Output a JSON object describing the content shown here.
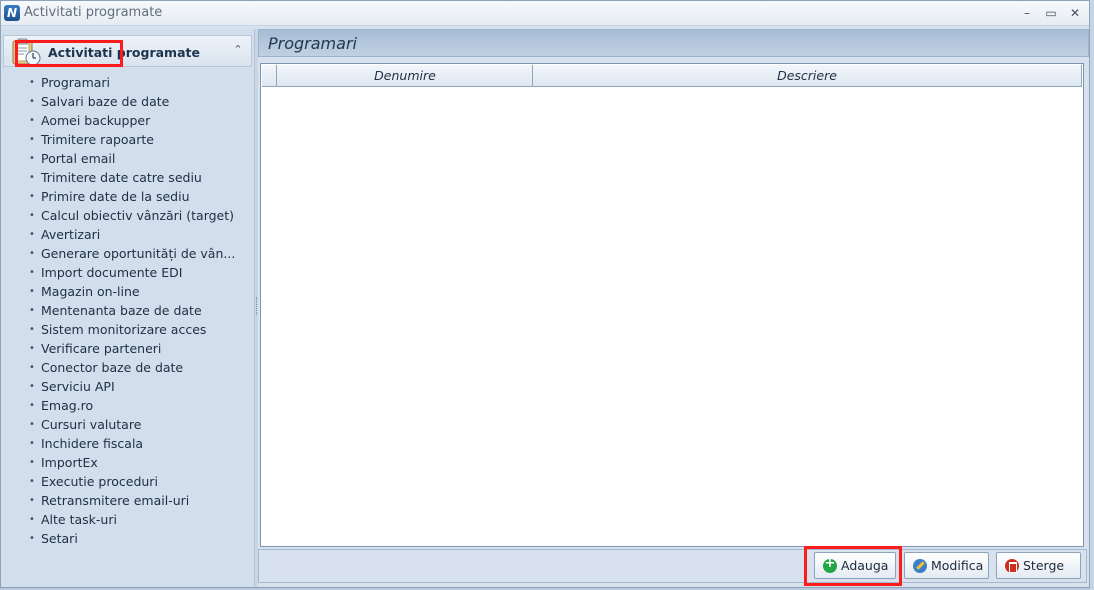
{
  "window": {
    "title": "Activitati programate",
    "icon_letter": "N",
    "controls": {
      "minimize": "–",
      "maximize": "▭",
      "close": "✕"
    }
  },
  "nav": {
    "header_title": "Activitati programate",
    "collapse_glyph": "⌃",
    "items": [
      "Programari",
      "Salvari baze de date",
      "Aomei backupper",
      "Trimitere rapoarte",
      "Portal email",
      "Trimitere date catre sediu",
      "Primire date de la sediu",
      "Calcul obiectiv vânzări (target)",
      "Avertizari",
      "Generare oportunități de vân...",
      "Import documente EDI",
      "Magazin on-line",
      "Mentenanta baze de date",
      "Sistem monitorizare acces",
      "Verificare parteneri",
      "Conector baze de date",
      "Serviciu API",
      "Emag.ro",
      "Cursuri valutare",
      "Inchidere fiscala",
      "ImportEx",
      "Executie proceduri",
      "Retransmitere email-uri",
      "Alte task-uri",
      "Setari"
    ],
    "selected": "Programari"
  },
  "main": {
    "title": "Programari",
    "columns": [
      "Denumire",
      "Descriere"
    ],
    "rows": [],
    "buttons": {
      "add": "Adauga",
      "edit": "Modifica",
      "delete": "Sterge"
    }
  },
  "colors": {
    "highlight": "#ff1b1b",
    "header_bg": "#a7bdd6",
    "nav_bg": "#d2deeb"
  }
}
